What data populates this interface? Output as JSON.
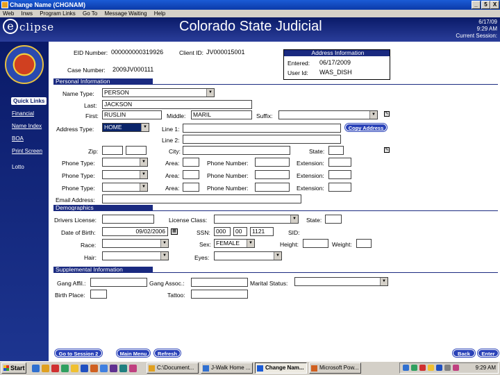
{
  "window": {
    "title": "Change Name (CHGNAM)",
    "buttons": [
      "_",
      "5",
      "X"
    ]
  },
  "menu": [
    "Web",
    "Inws",
    "Program Links",
    "Go To",
    "Message Waiting",
    "Help"
  ],
  "header": {
    "logo": "clipse",
    "title": "Colorado State Judicial",
    "date": "6/17/09",
    "time": "9:29 AM",
    "session": "Current Session:"
  },
  "sidebar": {
    "links": [
      "Quick Links",
      "Financial",
      "Name Index",
      "BOA",
      "Print Screen",
      "Lotto"
    ]
  },
  "top": {
    "eid_label": "EID Number:",
    "eid": "000000000319926",
    "client_label": "Client ID:",
    "client": "JV000015001",
    "case_label": "Case Number:",
    "case": "2009JV000111",
    "address_info": {
      "title": "Address Information",
      "entered_label": "Entered:",
      "entered": "06/17/2009",
      "userid_label": "User Id:",
      "userid": "WAS_DISH"
    }
  },
  "personal": {
    "section": "Personal Information",
    "name_type_label": "Name Type:",
    "name_type": "PERSON",
    "last_label": "Last:",
    "last": "JACKSON",
    "first_label": "First:",
    "first": "RUSLIN",
    "middle_label": "Middle:",
    "middle": "MARIL",
    "suffix_label": "Suffix:",
    "suffix": "",
    "addr_type_label": "Address Type:",
    "addr_type": "HOME",
    "line1_label": "Line 1:",
    "line1": "",
    "line2_label": "Line 2:",
    "line2": "",
    "copy_address": "Copy Address",
    "zip_label": "Zip:",
    "city_label": "City:",
    "state_label": "State:",
    "phone_type_label": "Phone Type:",
    "area_label": "Area:",
    "phone_number_label": "Phone Number:",
    "extension_label": "Extension:",
    "email_label": "Email Address:",
    "email": ""
  },
  "demographics": {
    "section": "Demographics",
    "dl_label": "Drivers License:",
    "license_class_label": "License Class:",
    "state_label": "State:",
    "dob_label": "Date of Birth:",
    "dob": "09/02/2006",
    "ssn_label": "SSN:",
    "ssn1": "000",
    "ssn2": "00",
    "ssn3": "1121",
    "sid_label": "SID:",
    "race_label": "Race:",
    "sex_label": "Sex:",
    "sex": "FEMALE",
    "height_label": "Height:",
    "weight_label": "Weight:",
    "hair_label": "Hair:",
    "eyes_label": "Eyes:"
  },
  "supplemental": {
    "section": "Supplemental Information",
    "gang_affil_label": "Gang Affil.:",
    "gang_assoc_label": "Gang Assoc.:",
    "marital_label": "Marital Status:",
    "birth_place_label": "Birth Place:",
    "tattoo_label": "Tattoo:"
  },
  "bottom_buttons": {
    "goto_session": "Go to Session 2",
    "main_menu": "Main Menu",
    "refresh": "Refresh",
    "back": "Back",
    "enter": "Enter"
  },
  "taskbar": {
    "start": "Start",
    "tasks": [
      "C:\\Document...",
      "J-Walk Home ...",
      "Change Nam...",
      "Microsoft Pow..."
    ],
    "clock": "9:29 AM"
  },
  "colors": {
    "header": "#0a1a68",
    "section": "#1a2a80",
    "button": "#2a42b8"
  }
}
